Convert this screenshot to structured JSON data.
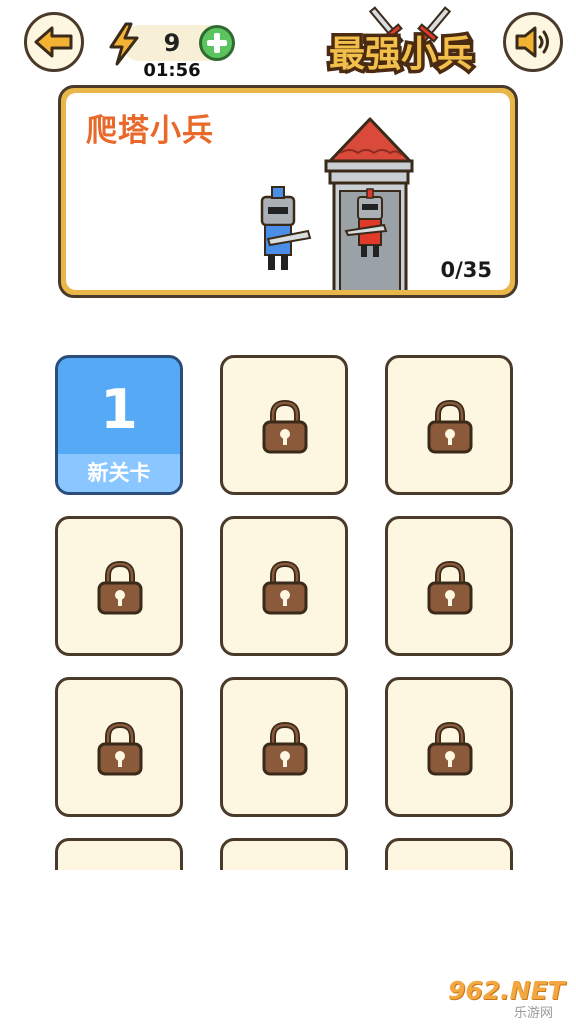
{
  "header": {
    "energy_count": "9",
    "timer": "01:56",
    "logo_text": "最强小兵"
  },
  "banner": {
    "title": "爬塔小兵",
    "progress": "0/35"
  },
  "levels": [
    {
      "number": "1",
      "label": "新关卡",
      "state": "unlocked"
    },
    {
      "state": "locked"
    },
    {
      "state": "locked"
    },
    {
      "state": "locked"
    },
    {
      "state": "locked"
    },
    {
      "state": "locked"
    },
    {
      "state": "locked"
    },
    {
      "state": "locked"
    },
    {
      "state": "locked"
    },
    {
      "state": "locked"
    },
    {
      "state": "locked"
    },
    {
      "state": "locked"
    }
  ],
  "watermark": {
    "main": "962.NET",
    "sub": "乐游网"
  },
  "colors": {
    "accent_orange": "#e8692a",
    "tile_locked_bg": "#fdf6e1",
    "tile_unlocked_bg": "#55a9f5",
    "outline": "#4a3a2a",
    "banner_frame": "#e9b64a",
    "plus_green": "#5cc45e",
    "lock_brown": "#8a5a3a"
  },
  "icons": {
    "back": "arrow-left-icon",
    "energy": "lightning-icon",
    "add": "plus-icon",
    "sound": "speaker-icon",
    "lock": "lock-icon"
  }
}
